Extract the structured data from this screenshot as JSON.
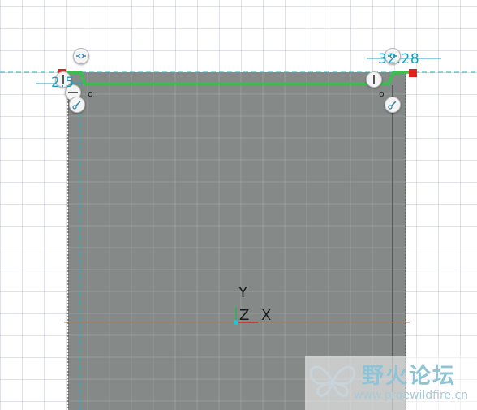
{
  "viewport": {
    "background": "#ffffff",
    "sketch_fill": "#858a88",
    "grid_color": "#a0aab4"
  },
  "dimensions": {
    "right_value": "32.28",
    "left_value": "2.5",
    "color": "#1a9fc0"
  },
  "profile": {
    "color": "#35c24a",
    "endpoint_color": "#e3201b"
  },
  "axes": {
    "y_label": "Y",
    "z_label": "Z",
    "x_label": "X",
    "origin_color": "#1fc6d8"
  },
  "markers": {
    "left_o": "o",
    "right_o": "o"
  },
  "icons": {
    "pin_handle": "pin-icon",
    "constraint_vertical": "vertical-constraint-icon",
    "constraint_horizontal": "horizontal-constraint-icon",
    "constraint_tangent": "tangent-constraint-icon"
  },
  "watermark": {
    "title": "野火论坛",
    "url": "www.proewildfire.cn"
  }
}
